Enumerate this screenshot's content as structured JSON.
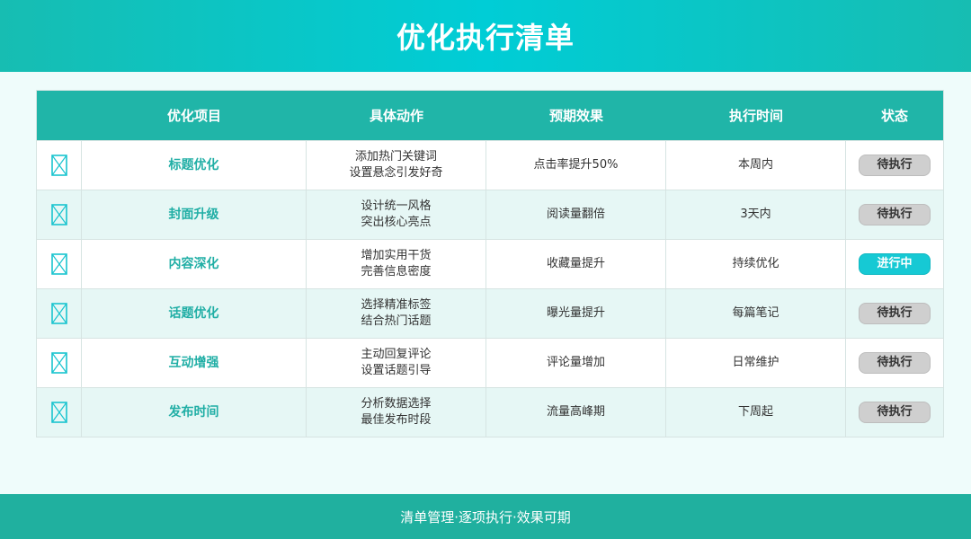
{
  "header": {
    "title": "优化执行清单"
  },
  "table": {
    "columns": [
      "",
      "优化项目",
      "具体动作",
      "预期效果",
      "执行时间",
      "状态"
    ],
    "rows": [
      {
        "item": "标题优化",
        "action": [
          "添加热门关键词",
          "设置悬念引发好奇"
        ],
        "effect": "点击率提升50%",
        "time": "本周内",
        "status": "待执行",
        "active": false
      },
      {
        "item": "封面升级",
        "action": [
          "设计统一风格",
          "突出核心亮点"
        ],
        "effect": "阅读量翻倍",
        "time": "3天内",
        "status": "待执行",
        "active": false
      },
      {
        "item": "内容深化",
        "action": [
          "增加实用干货",
          "完善信息密度"
        ],
        "effect": "收藏量提升",
        "time": "持续优化",
        "status": "进行中",
        "active": true
      },
      {
        "item": "话题优化",
        "action": [
          "选择精准标签",
          "结合热门话题"
        ],
        "effect": "曝光量提升",
        "time": "每篇笔记",
        "status": "待执行",
        "active": false
      },
      {
        "item": "互动增强",
        "action": [
          "主动回复评论",
          "设置话题引导"
        ],
        "effect": "评论量增加",
        "time": "日常维护",
        "status": "待执行",
        "active": false
      },
      {
        "item": "发布时间",
        "action": [
          "分析数据选择",
          "最佳发布时段"
        ],
        "effect": "流量高峰期",
        "time": "下周起",
        "status": "待执行",
        "active": false
      }
    ]
  },
  "footer": {
    "text": "清单管理·逐项执行·效果可期"
  },
  "colors": {
    "header_bg": "#00cdd6",
    "table_header_bg": "#20b5a8",
    "item_text": "#20aea5",
    "status_pending": "#cfcfcf",
    "status_active": "#16c9d4",
    "footer_bg": "#20b09f",
    "checkbox": "#19c4cf"
  },
  "icons": {
    "row_checkbox": "checkbox-empty-icon"
  }
}
